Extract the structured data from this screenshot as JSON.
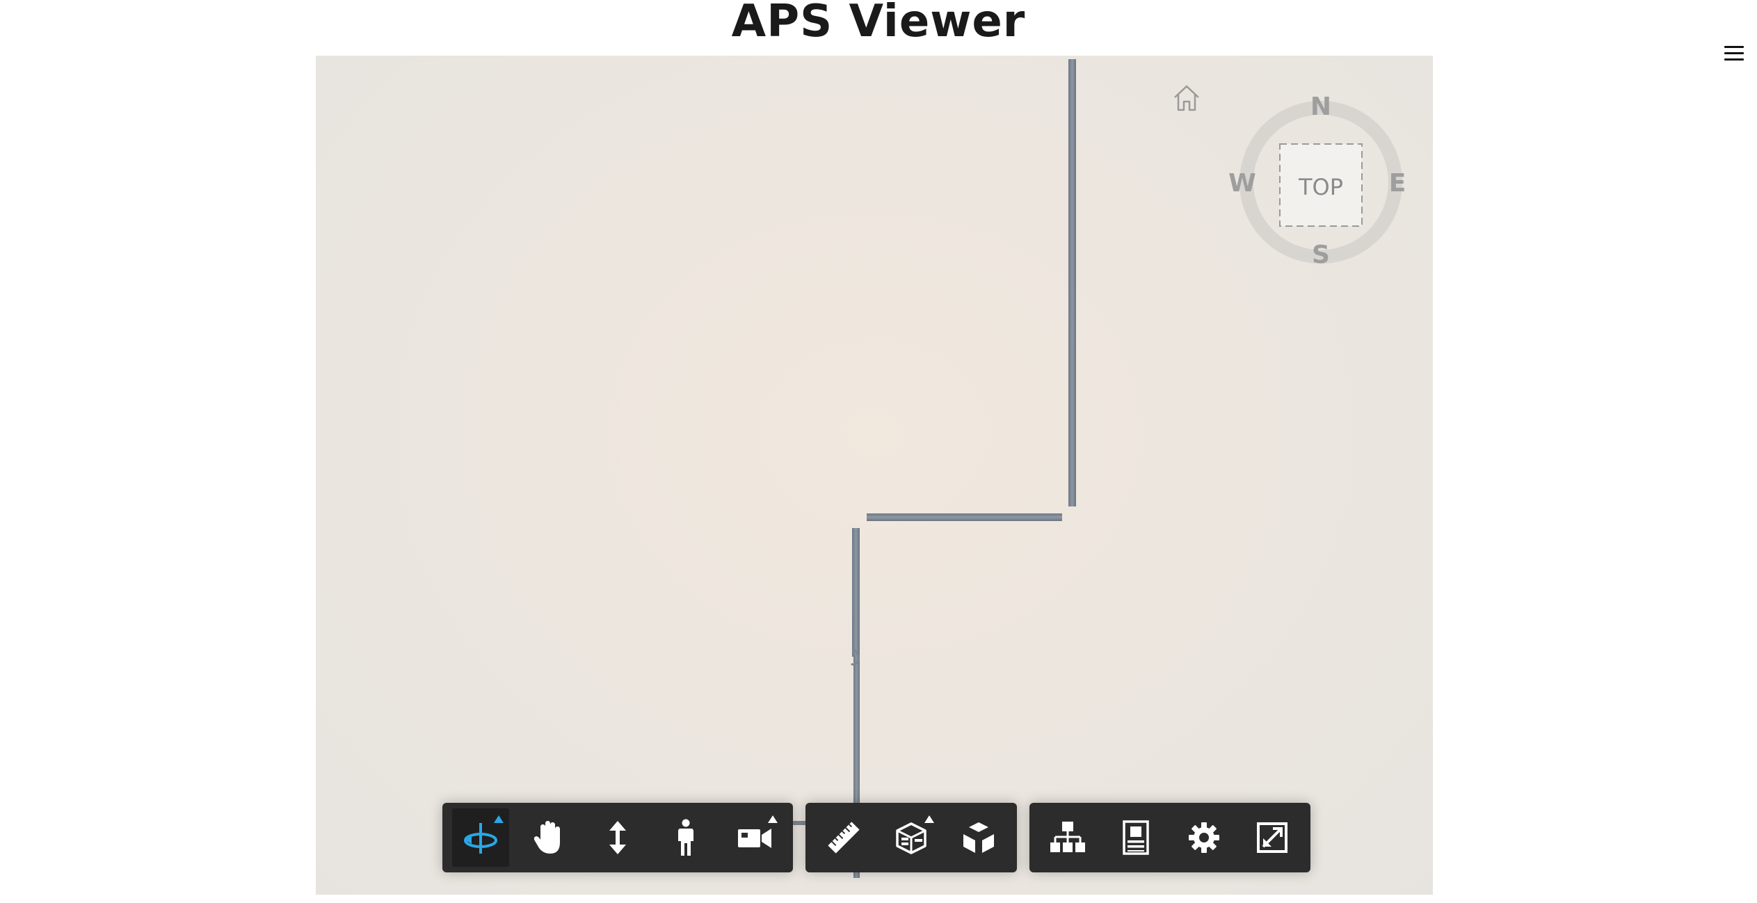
{
  "header": {
    "title": "APS Viewer"
  },
  "viewer": {
    "viewcube": {
      "face_label": "TOP",
      "compass": {
        "north": "N",
        "south": "S",
        "east": "E",
        "west": "W"
      }
    },
    "home_icon": "home-icon"
  },
  "toolbar": {
    "navigation": [
      {
        "id": "orbit",
        "icon": "orbit-icon",
        "active": true,
        "has_submenu": true
      },
      {
        "id": "pan",
        "icon": "hand-icon",
        "active": false,
        "has_submenu": false
      },
      {
        "id": "zoom",
        "icon": "dolly-icon",
        "active": false,
        "has_submenu": false
      },
      {
        "id": "first-person",
        "icon": "person-icon",
        "active": false,
        "has_submenu": false
      },
      {
        "id": "camera",
        "icon": "camera-icon",
        "active": false,
        "has_submenu": true
      }
    ],
    "modeling": [
      {
        "id": "measure",
        "icon": "ruler-icon",
        "has_submenu": false
      },
      {
        "id": "section",
        "icon": "section-box-icon",
        "has_submenu": true
      },
      {
        "id": "explode",
        "icon": "explode-cube-icon",
        "has_submenu": false
      }
    ],
    "settings": [
      {
        "id": "model-browser",
        "icon": "hierarchy-icon"
      },
      {
        "id": "properties",
        "icon": "properties-icon"
      },
      {
        "id": "settings",
        "icon": "gear-icon"
      },
      {
        "id": "fullscreen",
        "icon": "fullscreen-icon"
      }
    ],
    "colors": {
      "bar": "#2c2c2c",
      "icon": "#ffffff",
      "active": "#2aa7e6"
    }
  }
}
